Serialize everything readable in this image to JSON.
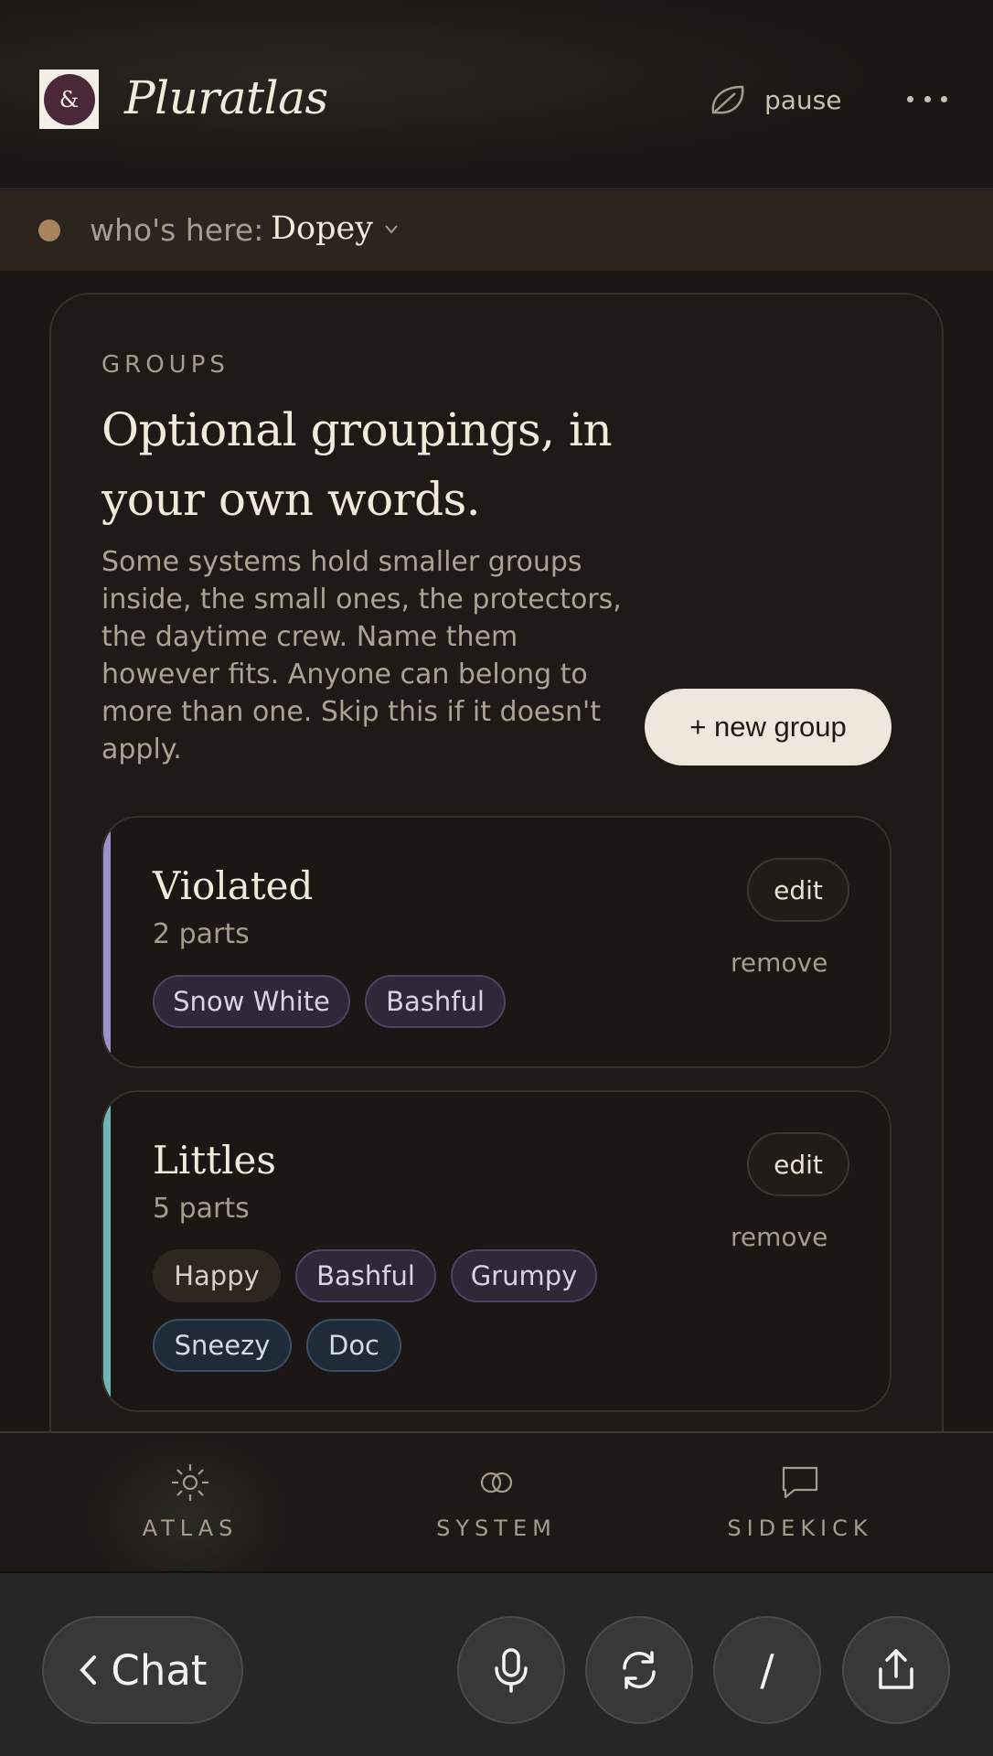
{
  "header": {
    "app_title": "Pluratlas",
    "logo_glyph": "&",
    "pause_label": "pause",
    "more_icon": "more-icon"
  },
  "presence": {
    "label": "who's here:",
    "name": "Dopey",
    "status_color": "#a7845d"
  },
  "groups_section": {
    "eyebrow": "GROUPS",
    "heading": "Optional groupings, in your own words.",
    "description": "Some systems hold smaller groups inside, the small ones, the protectors, the daytime crew. Name them however fits. Anyone can belong to more than one. Skip this if it doesn't apply.",
    "new_group_label": "+ new group",
    "groups": [
      {
        "name": "Violated",
        "count": "2 parts",
        "accent": "#9a92c8",
        "edit_label": "edit",
        "remove_label": "remove",
        "members": [
          "Snow White",
          "Bashful"
        ]
      },
      {
        "name": "Littles",
        "count": "5 parts",
        "accent": "#6fb5b5",
        "edit_label": "edit",
        "remove_label": "remove",
        "members": [
          "Happy",
          "Bashful",
          "Grumpy",
          "Sneezy",
          "Doc"
        ]
      }
    ]
  },
  "tabbar": {
    "tabs": [
      {
        "label": "ATLAS",
        "icon": "sun-icon"
      },
      {
        "label": "SYSTEM",
        "icon": "rings-icon"
      },
      {
        "label": "SIDEKICK",
        "icon": "chat-bubble-icon"
      }
    ]
  },
  "os_bar": {
    "chat_label": "Chat",
    "slash_label": "/"
  }
}
